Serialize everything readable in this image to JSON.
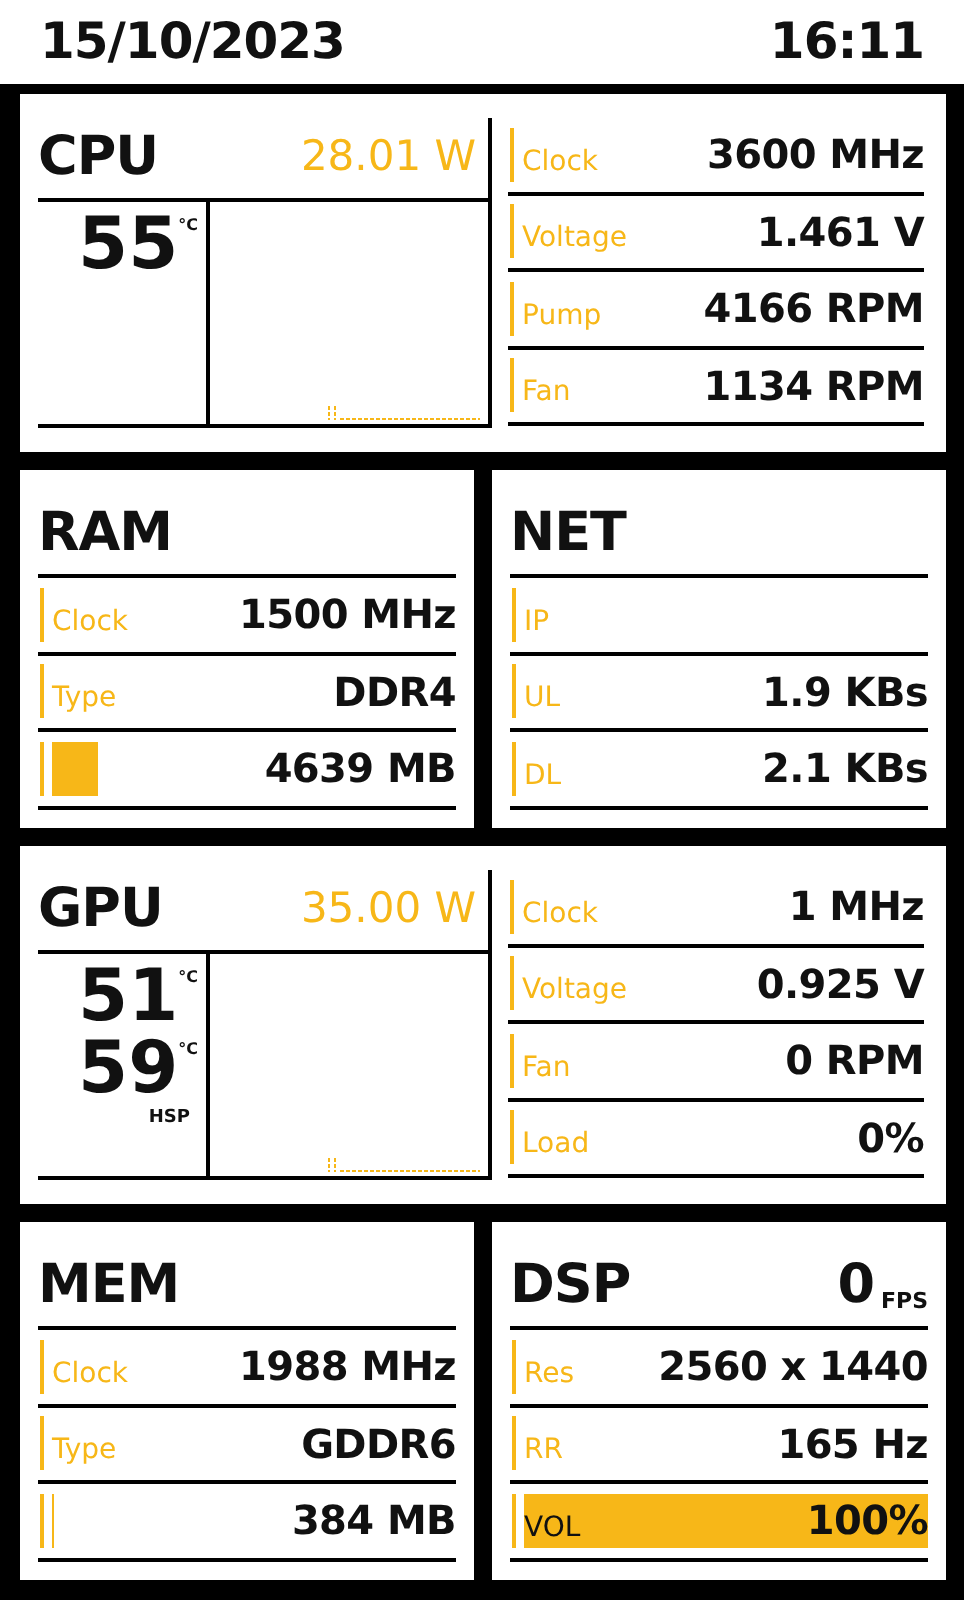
{
  "header": {
    "date": "15/10/2023",
    "time": "16:11"
  },
  "panels": [
    {
      "kind": "wide",
      "title": "CPU",
      "power": "28.01 W",
      "temps": [
        {
          "value": "55",
          "unit": "°C"
        }
      ],
      "rows": [
        {
          "kind": "text",
          "label": "Clock",
          "value": "3600 MHz"
        },
        {
          "kind": "text",
          "label": "Voltage",
          "value": "1.461 V"
        },
        {
          "kind": "text",
          "label": "Pump",
          "value": "4166 RPM"
        },
        {
          "kind": "text",
          "label": "Fan",
          "value": "1134 RPM"
        }
      ]
    },
    {
      "kind": "half",
      "title": "RAM",
      "rows": [
        {
          "kind": "text",
          "label": "Clock",
          "value": "1500 MHz"
        },
        {
          "kind": "text",
          "label": "Type",
          "value": "DDR4"
        },
        {
          "kind": "bar",
          "level": 0.13,
          "value": "4639 MB"
        }
      ]
    },
    {
      "kind": "half",
      "title": "NET",
      "rows": [
        {
          "kind": "text",
          "label": "IP"
        },
        {
          "kind": "text",
          "label": "UL",
          "value": "1.9 KBs"
        },
        {
          "kind": "text",
          "label": "DL",
          "value": "2.1 KBs"
        }
      ]
    },
    {
      "kind": "wide",
      "title": "GPU",
      "power": "35.00 W",
      "temps": [
        {
          "value": "51",
          "unit": "°C"
        },
        {
          "value": "59",
          "unit": "°C",
          "caption": "HSP"
        }
      ],
      "rows": [
        {
          "kind": "text",
          "label": "Clock",
          "value": "1 MHz"
        },
        {
          "kind": "text",
          "label": "Voltage",
          "value": "0.925 V"
        },
        {
          "kind": "text",
          "label": "Fan",
          "value": "0 RPM"
        },
        {
          "kind": "text",
          "label": "Load",
          "value": "0%"
        }
      ]
    },
    {
      "kind": "half",
      "title": "MEM",
      "rows": [
        {
          "kind": "text",
          "label": "Clock",
          "value": "1988 MHz"
        },
        {
          "kind": "text",
          "label": "Type",
          "value": "GDDR6"
        },
        {
          "kind": "bar",
          "level": 0.02,
          "value": "384 MB"
        }
      ]
    },
    {
      "kind": "half",
      "title": "DSP",
      "fps": {
        "value": "0",
        "unit": "FPS"
      },
      "rows": [
        {
          "kind": "text",
          "label": "Res",
          "value": "2560 x 1440"
        },
        {
          "kind": "text",
          "label": "RR",
          "value": "165 Hz"
        },
        {
          "kind": "bar",
          "level": 1,
          "label": "VOL",
          "value": "100%"
        }
      ]
    }
  ]
}
